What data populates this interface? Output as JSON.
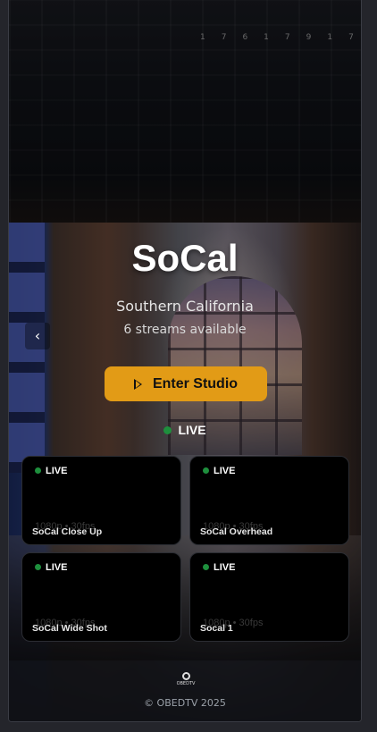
{
  "hero": {
    "title": "SoCal",
    "subtitle": "Southern California",
    "streams_count": "6 streams available",
    "prev_label": "‹",
    "enter_label": "Enter Studio",
    "live_label": "LIVE"
  },
  "streams": [
    {
      "live": "LIVE",
      "meta": "1080p • 30fps",
      "name": "SoCal Close Up"
    },
    {
      "live": "LIVE",
      "meta": "1080p • 30fps",
      "name": "SoCal Overhead"
    },
    {
      "live": "LIVE",
      "meta": "1080p • 30fps",
      "name": "SoCal Wide Shot"
    },
    {
      "live": "LIVE",
      "meta": "1080p • 30fps",
      "name": "Socal 1"
    }
  ],
  "footer": {
    "logo_text": "OBEDTV",
    "copyright": "© OBEDTV 2025"
  },
  "colors": {
    "accent": "#e29b16",
    "live_dot": "#1e8f3d"
  }
}
